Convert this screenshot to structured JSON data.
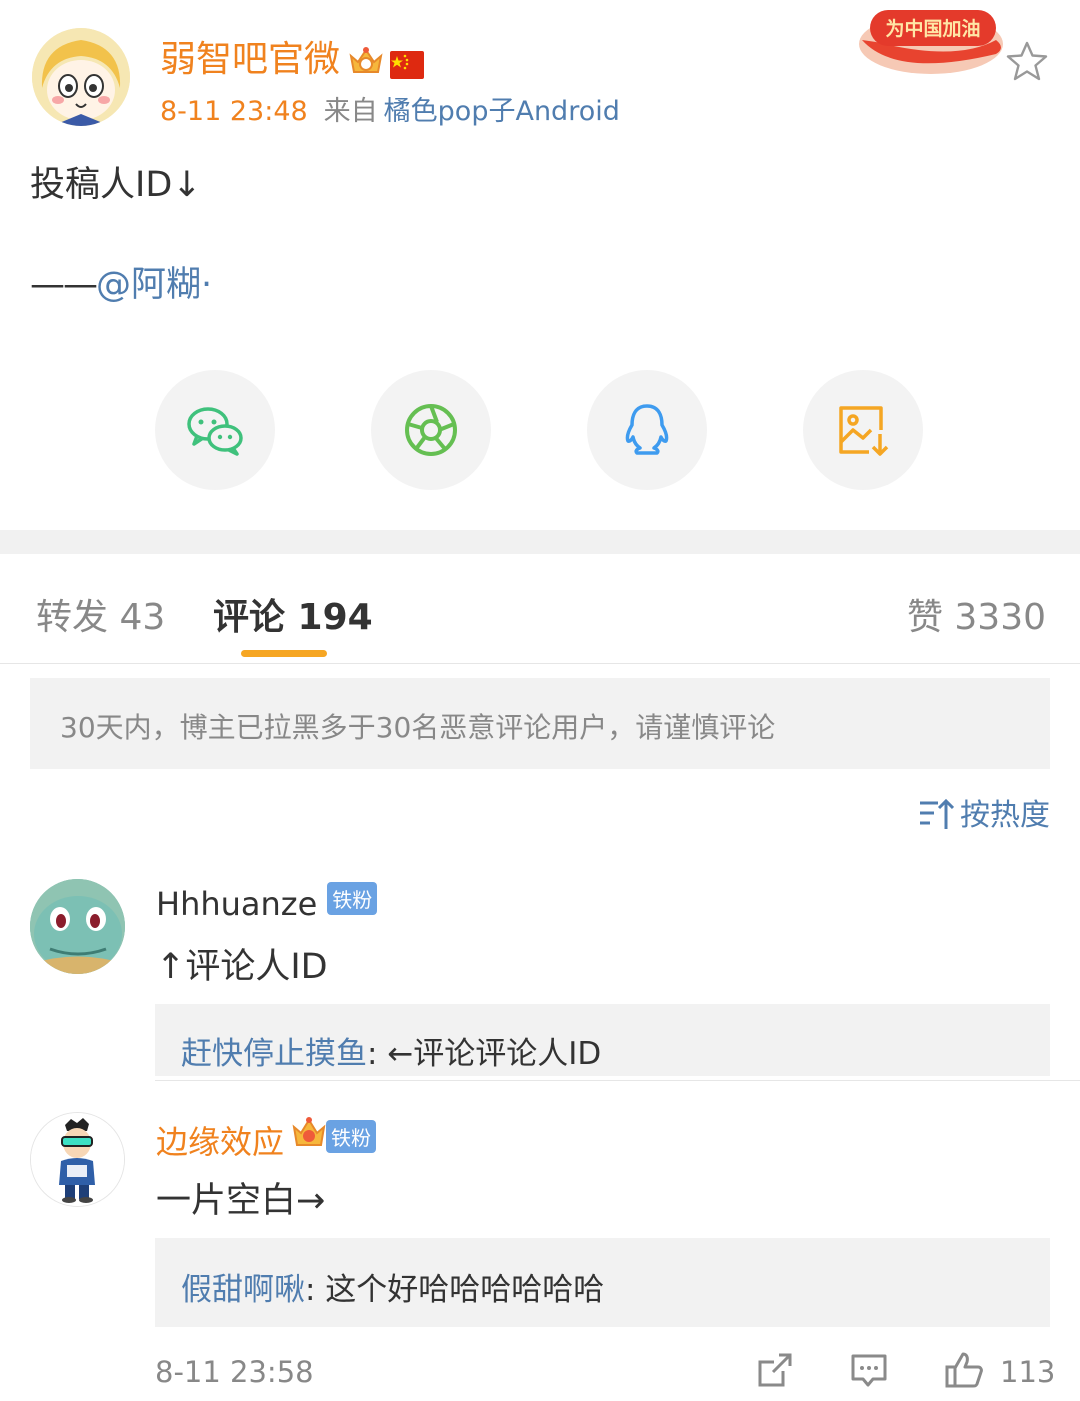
{
  "post": {
    "author": "弱智吧官微",
    "time": "8-11 23:48",
    "from_label": "来自",
    "source": "橘色pop子Android",
    "promo_badge": "为中国加油",
    "content_line1": "投稿人ID↓",
    "dash": "——",
    "mention": "@阿糊·"
  },
  "share": [
    "wechat-icon",
    "moments-icon",
    "qq-icon",
    "save-image-icon"
  ],
  "tabs": {
    "reposts": "转发 43",
    "comments": "评论 194",
    "likes": "赞 3330"
  },
  "notice": "30天内，博主已拉黑多于30名恶意评论用户，请谨慎评论",
  "sort_label": "按热度",
  "comments": [
    {
      "user": "Hhhuanze",
      "badge": "铁粉",
      "text": "↑评论人ID",
      "reply_user": "赶快停止摸鱼",
      "reply_text": ": ←评论评论人ID"
    },
    {
      "user": "边缘效应",
      "badge": "铁粉",
      "text": "一片空白→",
      "reply_user": "假甜啊啾",
      "reply_text": ": 这个好哈哈哈哈哈哈",
      "time": "8-11 23:58",
      "likes": "113"
    }
  ],
  "colors": {
    "accent_orange": "#f0821e",
    "link_blue": "#507daf",
    "tab_indicator": "#f6a623"
  }
}
